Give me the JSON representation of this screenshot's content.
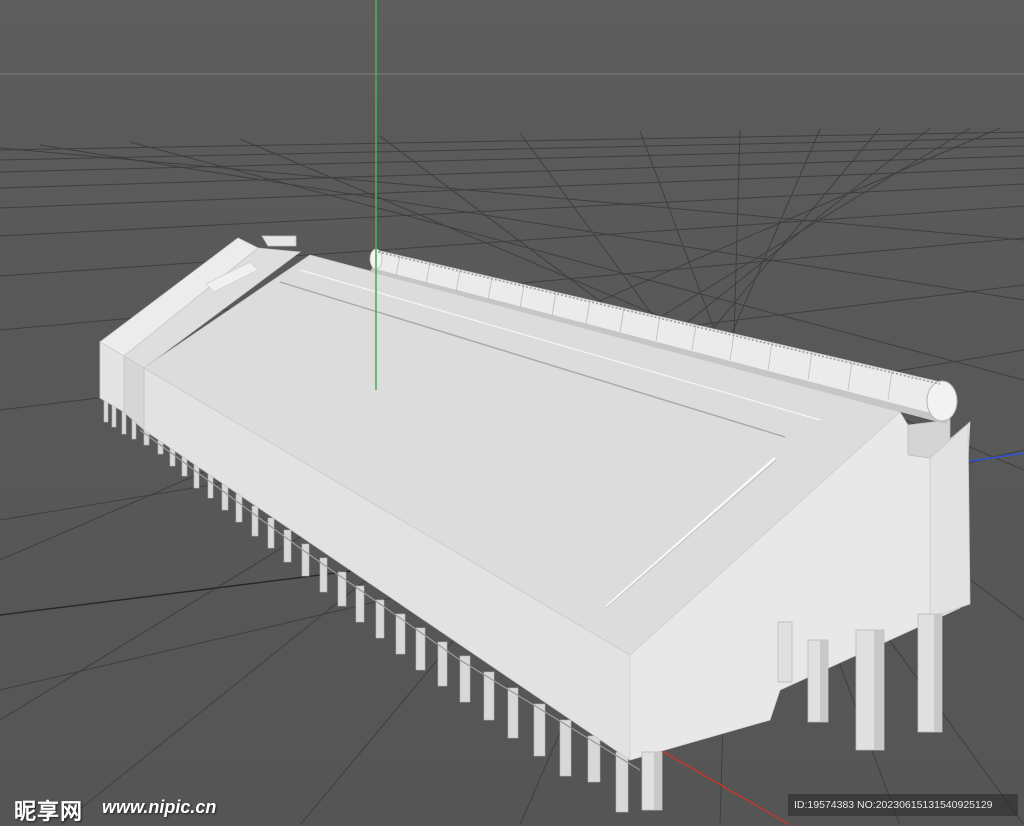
{
  "viewport": {
    "background_color": "#5a5a5a",
    "grid_color": "#3e3e3e",
    "model_color": "#e6e6e6",
    "y_axis_color": "#4caf50",
    "x_axis_color": "#c0392b",
    "z_axis_color": "#3050d0"
  },
  "watermark": {
    "logo_text": "昵享网",
    "url_text": "www.nipic.cn",
    "id_text": "ID:19574383 NO:20230615131540925129"
  }
}
